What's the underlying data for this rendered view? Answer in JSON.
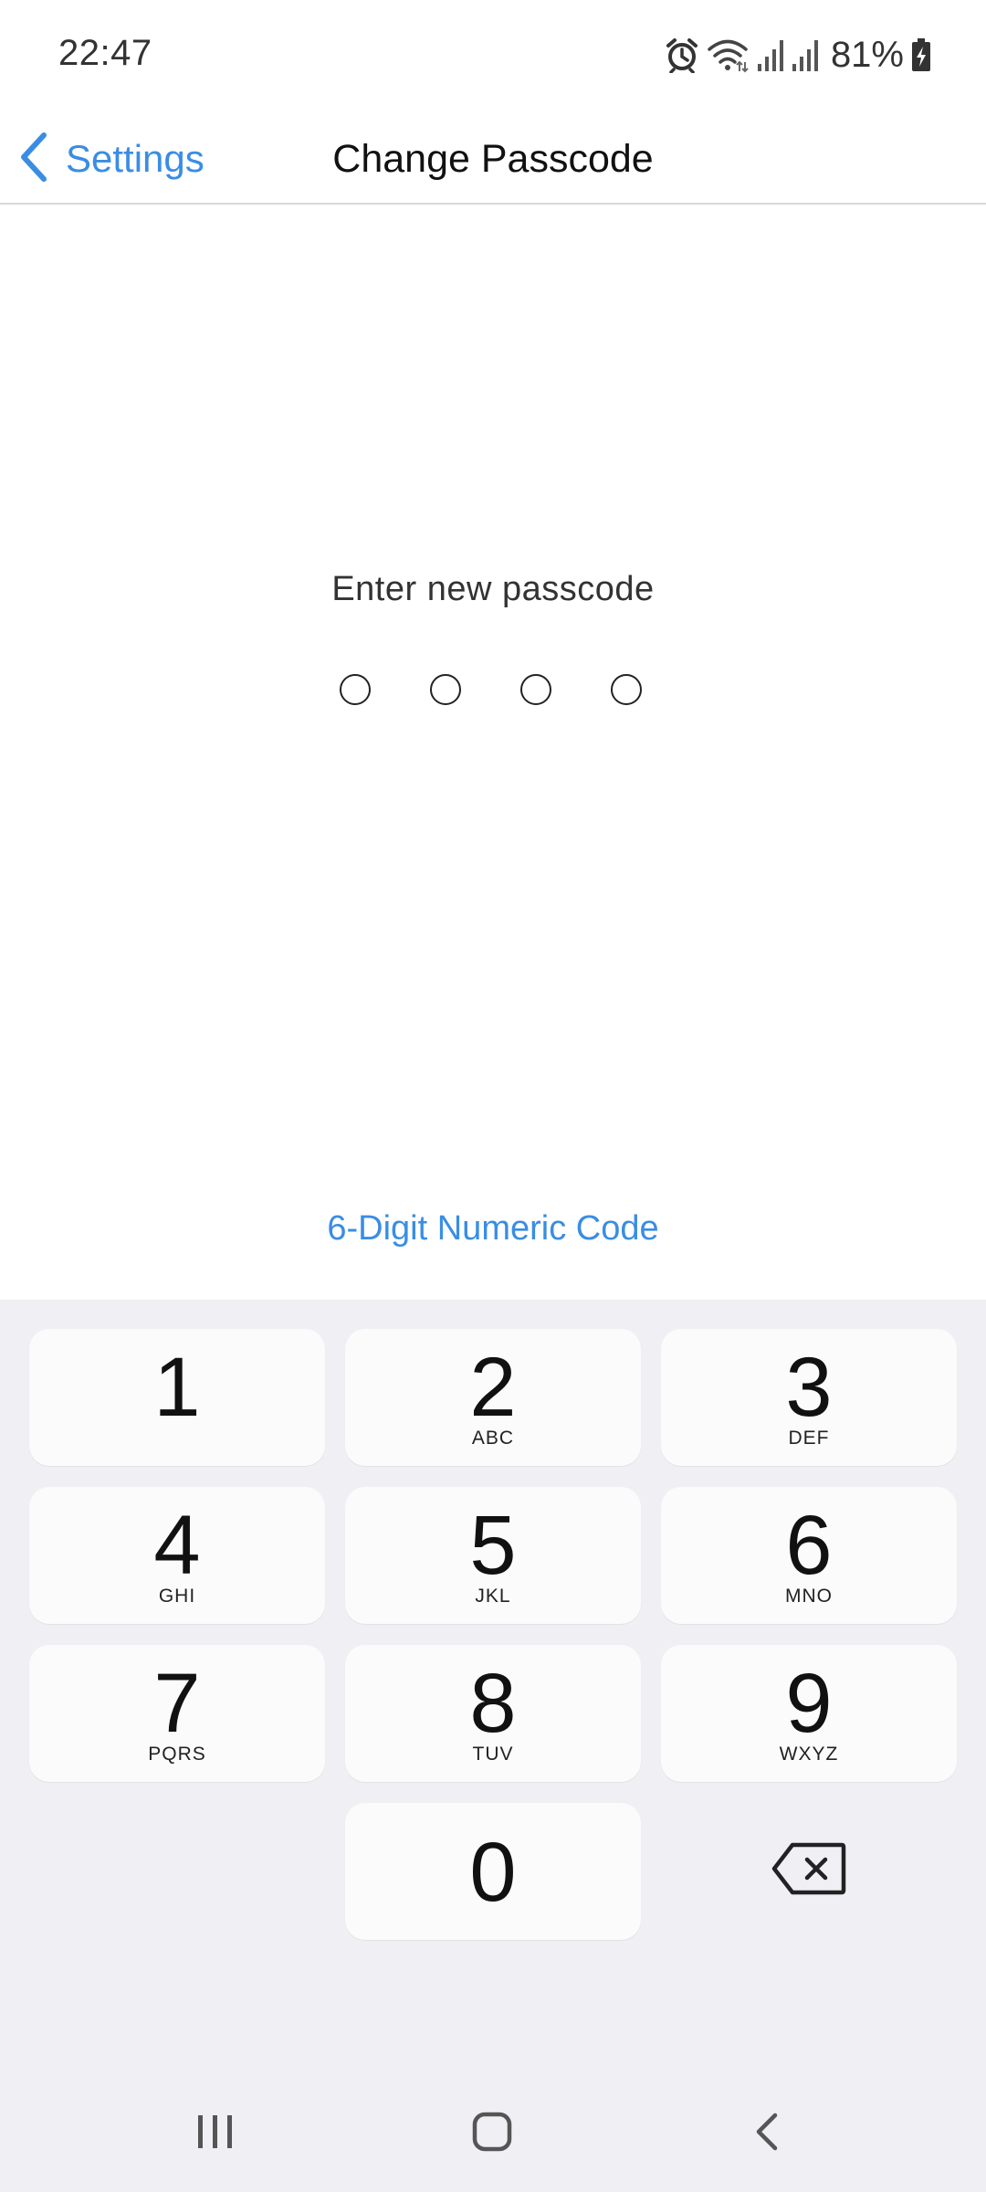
{
  "status_bar": {
    "time": "22:47",
    "battery": "81%",
    "icons": [
      "alarm-icon",
      "wifi-icon",
      "signal-icon",
      "signal-icon",
      "battery-charging-icon"
    ]
  },
  "nav": {
    "back_label": "Settings",
    "title": "Change Passcode",
    "back_icon": "chevron-left-icon"
  },
  "passcode": {
    "prompt": "Enter new passcode",
    "digits_total": 4,
    "digits_entered": 0,
    "option_link": "6-Digit Numeric Code"
  },
  "keypad": {
    "keys": [
      {
        "digit": "1",
        "letters": ""
      },
      {
        "digit": "2",
        "letters": "ABC"
      },
      {
        "digit": "3",
        "letters": "DEF"
      },
      {
        "digit": "4",
        "letters": "GHI"
      },
      {
        "digit": "5",
        "letters": "JKL"
      },
      {
        "digit": "6",
        "letters": "MNO"
      },
      {
        "digit": "7",
        "letters": "PQRS"
      },
      {
        "digit": "8",
        "letters": "TUV"
      },
      {
        "digit": "9",
        "letters": "WXYZ"
      },
      {
        "digit": "0",
        "letters": ""
      }
    ],
    "delete_icon": "backspace-icon"
  },
  "system_nav": {
    "buttons": [
      "recents-icon",
      "home-icon",
      "back-icon"
    ]
  },
  "colors": {
    "accent": "#3a8de3",
    "keypad_bg": "#efeff4",
    "key_bg": "#fbfbfb"
  }
}
